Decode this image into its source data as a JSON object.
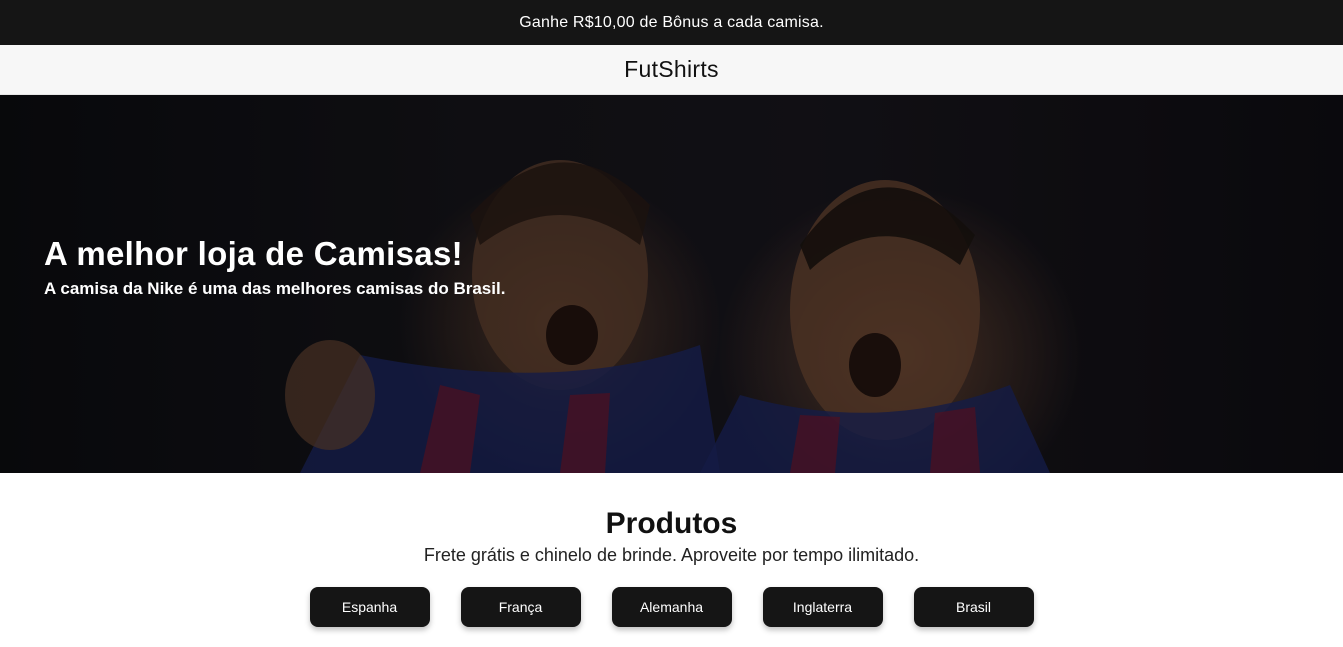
{
  "promo": {
    "text": "Ganhe R$10,00 de Bônus a cada camisa."
  },
  "header": {
    "brand": "FutShirts"
  },
  "hero": {
    "title": "A melhor loja de Camisas!",
    "subtitle": "A camisa da Nike é uma das melhores camisas do Brasil."
  },
  "products": {
    "title": "Produtos",
    "subtitle": "Frete grátis e chinelo de brinde. Aproveite por tempo ilimitado.",
    "countries": [
      "Espanha",
      "França",
      "Alemanha",
      "Inglaterra",
      "Brasil"
    ]
  },
  "colors": {
    "dark": "#151515",
    "header_bg": "#f7f7f7",
    "jersey_blue": "#1f2a6b",
    "jersey_red": "#7a1830"
  }
}
